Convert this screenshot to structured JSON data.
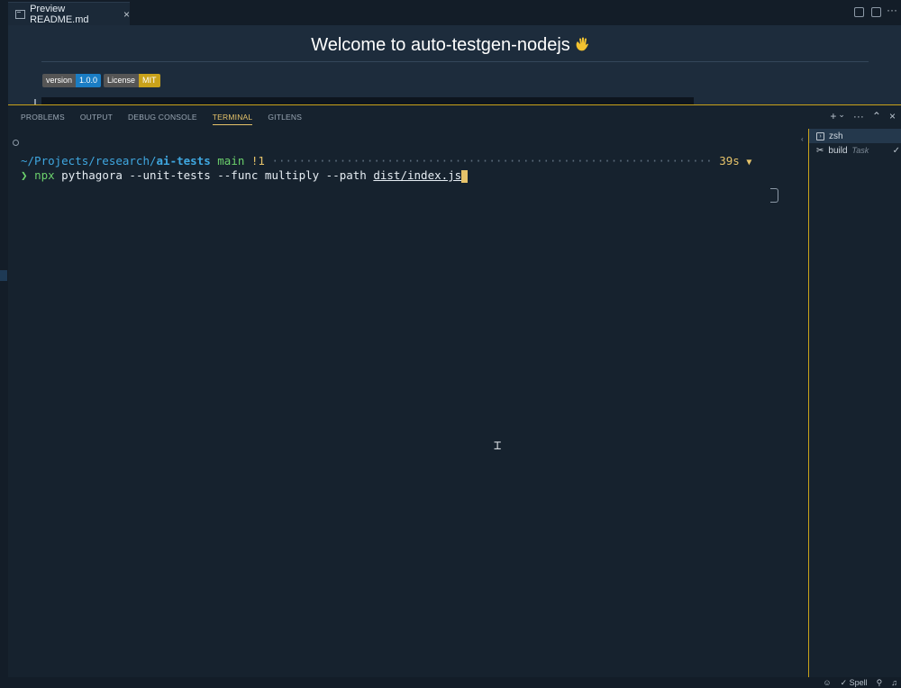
{
  "tab": {
    "title": "Preview README.md",
    "close": "×",
    "icon": "preview-icon"
  },
  "preview": {
    "title": "Welcome to auto-testgen-nodejs",
    "badges": {
      "version": {
        "label": "version",
        "value": "1.0.0"
      },
      "license": {
        "label": "License",
        "value": "MIT"
      }
    }
  },
  "panel": {
    "tabs": [
      "PROBLEMS",
      "OUTPUT",
      "DEBUG CONSOLE",
      "TERMINAL",
      "GITLENS"
    ],
    "active_tab": "TERMINAL",
    "actions": {
      "add": "+",
      "split": "⌄",
      "more": "···",
      "maximize": "⌃",
      "close": "×"
    }
  },
  "terminal": {
    "prompt": {
      "path_prefix": "~/Projects/research/",
      "path_dir": "ai-tests",
      "branch": "main",
      "dirty": "!1",
      "dots": "·································································",
      "duration": "39s",
      "duration_marker": "▼"
    },
    "command": {
      "chevron": "❯",
      "npx": "npx",
      "args": " pythagora --unit-tests --func multiply --path ",
      "path": "dist/index.js"
    }
  },
  "terminal_list": [
    {
      "name": "zsh",
      "sub": "",
      "icon": "terminal-icon"
    },
    {
      "name": "build",
      "sub": "Task",
      "icon": "tools-icon",
      "check": "✓"
    }
  ],
  "statusbar": {
    "spell": "✓ Spell"
  },
  "colors": {
    "accent": "#c9a21a",
    "background": "#16222e",
    "path": "#3fa7e0",
    "branch": "#6cd16c"
  }
}
